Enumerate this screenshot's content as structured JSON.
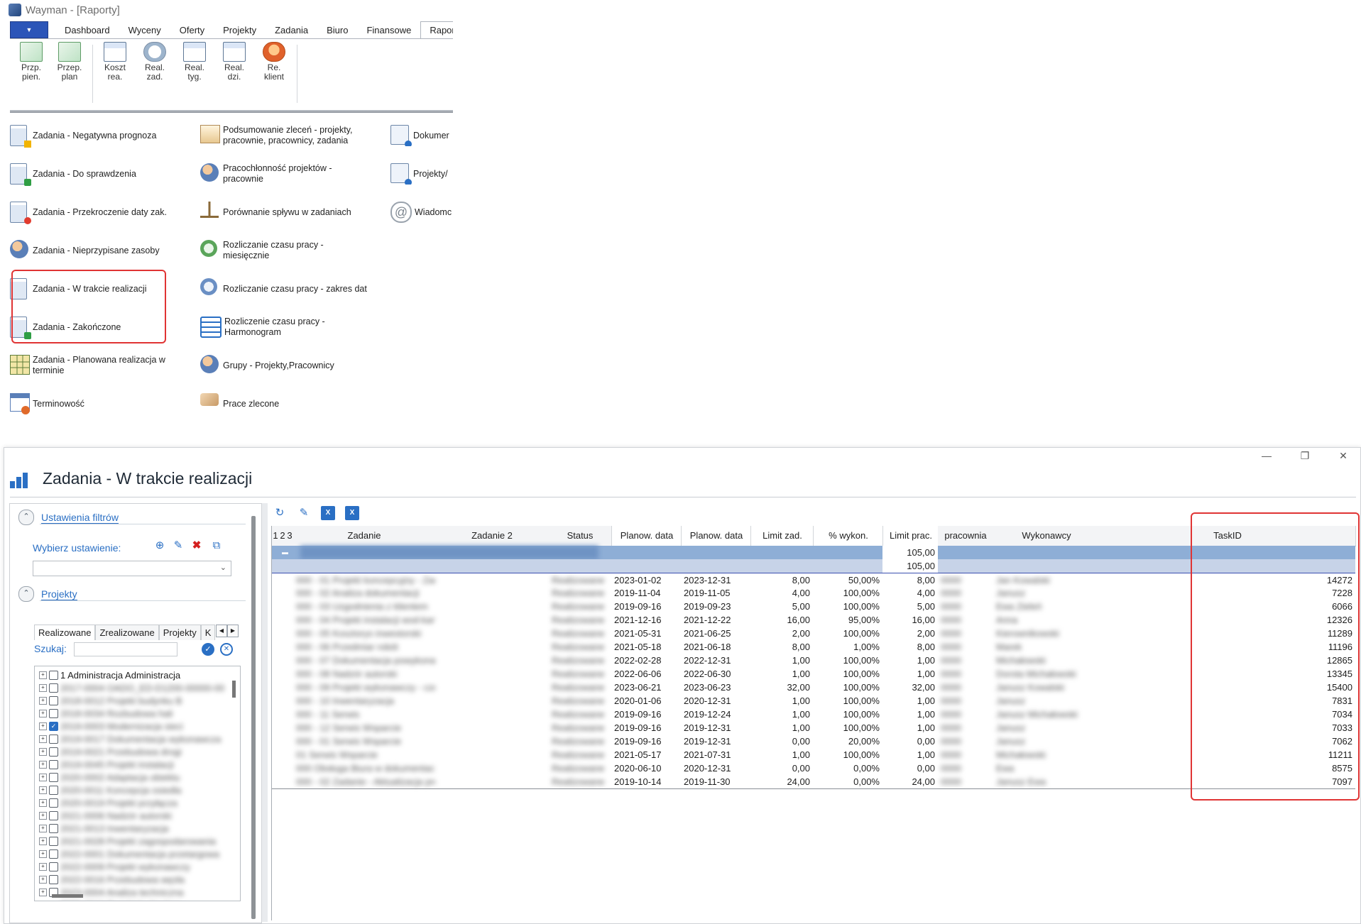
{
  "app": {
    "title": "Wayman - [Raporty]",
    "menu_arrow": "▼"
  },
  "tabs": [
    "Dashboard",
    "Wyceny",
    "Oferty",
    "Projekty",
    "Zadania",
    "Biuro",
    "Finansowe",
    "Raporty"
  ],
  "active_tab": "Raporty",
  "ribbon": [
    {
      "line1": "Przp.",
      "line2": "pien.",
      "icon": "chart-icon"
    },
    {
      "line1": "Przep.",
      "line2": "plan",
      "icon": "chart-icon"
    },
    {
      "line1": "Koszt",
      "line2": "rea.",
      "icon": "calendar-icon"
    },
    {
      "line1": "Real.",
      "line2": "zad.",
      "icon": "clock-icon"
    },
    {
      "line1": "Real.",
      "line2": "tyg.",
      "icon": "calendar-icon"
    },
    {
      "line1": "Real.",
      "line2": "dzi.",
      "icon": "calendar-icon"
    },
    {
      "line1": "Re.",
      "line2": "klient",
      "icon": "person-icon"
    }
  ],
  "reports": {
    "col1": [
      "Zadania - Negatywna prognoza",
      "Zadania - Do sprawdzenia",
      "Zadania - Przekroczenie  daty zak.",
      "Zadania - Nieprzypisane zasoby",
      "Zadania - W trakcie realizacji",
      "Zadania - Zakończone",
      "Zadania - Planowana realizacja w terminie",
      "Terminowość"
    ],
    "col2": [
      "Podsumowanie zleceń - projekty, pracownie, pracownicy, zadania",
      "Pracochłonność projektów - pracownie",
      "Porównanie spływu w zadaniach",
      "Rozliczanie czasu pracy - miesięcznie",
      "Rozliczanie czasu pracy - zakres dat",
      "Rozliczenie czasu pracy - Harmonogram",
      "Grupy - Projekty,Pracownicy",
      "Prace zlecone"
    ],
    "col3": [
      "Dokumer",
      "Projekty/",
      "Wiadomc"
    ]
  },
  "report_window": {
    "title": "Zadania - W trakcie realizacji",
    "controls": {
      "minimize": "—",
      "restore": "❐",
      "close": "✕"
    }
  },
  "filters": {
    "section1": "Ustawienia filtrów",
    "choose_label": "Wybierz ustawienie:",
    "section2": "Projekty",
    "subtabs": [
      "Realizowane",
      "Zrealizowane",
      "Projekty",
      "K"
    ],
    "search_label": "Szukaj:",
    "search_value": "",
    "tree": [
      {
        "label": "1 Administracja Administracja",
        "checked": false,
        "blurred": false
      },
      {
        "label": "2017-0004 OADO_ED-D1200-00000-00",
        "checked": false,
        "blurred": true
      },
      {
        "label": "2018-0012 Projekt budynku B",
        "checked": false,
        "blurred": true
      },
      {
        "label": "2018-0034 Rozbudowa hali",
        "checked": false,
        "blurred": true
      },
      {
        "label": "2019-0003 Modernizacja sieci",
        "checked": true,
        "blurred": true
      },
      {
        "label": "2019-0017 Dokumentacja wykonawcza",
        "checked": false,
        "blurred": true
      },
      {
        "label": "2019-0021 Przebudowa drogi",
        "checked": false,
        "blurred": true
      },
      {
        "label": "2019-0045 Projekt instalacji",
        "checked": false,
        "blurred": true
      },
      {
        "label": "2020-0002 Adaptacja obiektu",
        "checked": false,
        "blurred": true
      },
      {
        "label": "2020-0011 Koncepcja osiedla",
        "checked": false,
        "blurred": true
      },
      {
        "label": "2020-0019 Projekt przyłącza",
        "checked": false,
        "blurred": true
      },
      {
        "label": "2021-0006 Nadzór autorski",
        "checked": false,
        "blurred": true
      },
      {
        "label": "2021-0013 Inwentaryzacja",
        "checked": false,
        "blurred": true
      },
      {
        "label": "2021-0028 Projekt zagospodarowania",
        "checked": false,
        "blurred": true
      },
      {
        "label": "2022-0001 Dokumentacja przetargowa",
        "checked": false,
        "blurred": true
      },
      {
        "label": "2022-0009 Projekt wykonawczy",
        "checked": false,
        "blurred": true
      },
      {
        "label": "2022-0016 Przebudowa węzła",
        "checked": false,
        "blurred": true
      },
      {
        "label": "2023-0004 Analiza techniczna",
        "checked": false,
        "blurred": true
      },
      {
        "label": "2023-0010 Projekt budowlany",
        "checked": false,
        "blurred": true
      },
      {
        "label": "2023-0015 Ekspertyza",
        "checked": false,
        "blurred": true
      },
      {
        "label": "2023-0022 Studium wykonalności",
        "checked": false,
        "blurred": true
      },
      {
        "label": "202 - 01 - 120 - 1180 - Zadanie - Serwis",
        "checked": false,
        "blurred": true
      }
    ]
  },
  "grid": {
    "headers": [
      "1",
      "2",
      "3",
      "Zadanie",
      "Zadanie 2",
      "Status",
      "Planow. data",
      "Planow. data",
      "Limit zad.",
      "% wykon.",
      "Limit prac.",
      "pracownia",
      "Wykonawcy",
      "TaskID"
    ],
    "group_totals": [
      "105,00",
      "105,00"
    ],
    "rows": [
      {
        "zad": "000 - 01 Projekt koncepcyjny - Zadanie",
        "status": "Realizowane",
        "start": "2023-01-02",
        "end": "2023-12-31",
        "limit": "8,00",
        "pct": "50,00%",
        "lp": "8,00",
        "prac": "0000",
        "wyk": "Jan Kowalski",
        "id": "14272"
      },
      {
        "zad": "000 - 02 Analiza dokumentacji",
        "status": "Realizowane",
        "start": "2019-11-04",
        "end": "2019-11-05",
        "limit": "4,00",
        "pct": "100,00%",
        "lp": "4,00",
        "prac": "0000",
        "wyk": "Janusz",
        "id": "7228"
      },
      {
        "zad": "000 - 03 Uzgodnienia z klientem",
        "status": "Realizowane",
        "start": "2019-09-16",
        "end": "2019-09-23",
        "limit": "5,00",
        "pct": "100,00%",
        "lp": "5,00",
        "prac": "0000",
        "wyk": "Ewa Zieleń",
        "id": "6066"
      },
      {
        "zad": "000 - 04 Projekt instalacji wod-kan",
        "status": "Realizowane",
        "start": "2021-12-16",
        "end": "2021-12-22",
        "limit": "16,00",
        "pct": "95,00%",
        "lp": "16,00",
        "prac": "0000",
        "wyk": "Anna",
        "id": "12326"
      },
      {
        "zad": "000 - 05 Kosztorys inwestorski",
        "status": "Realizowane",
        "start": "2021-05-31",
        "end": "2021-06-25",
        "limit": "2,00",
        "pct": "100,00%",
        "lp": "2,00",
        "prac": "0000",
        "wyk": "Kierownikowski",
        "id": "11289"
      },
      {
        "zad": "000 - 06 Przedmiar robót",
        "status": "Realizowane",
        "start": "2021-05-18",
        "end": "2021-06-18",
        "limit": "8,00",
        "pct": "1,00%",
        "lp": "8,00",
        "prac": "0000",
        "wyk": "Marek",
        "id": "11196"
      },
      {
        "zad": "000 - 07 Dokumentacja powykonawcza",
        "status": "Realizowane",
        "start": "2022-02-28",
        "end": "2022-12-31",
        "limit": "1,00",
        "pct": "100,00%",
        "lp": "1,00",
        "prac": "0000",
        "wyk": "Michałowski",
        "id": "12865"
      },
      {
        "zad": "000 - 08 Nadzór autorski",
        "status": "Realizowane",
        "start": "2022-06-06",
        "end": "2022-06-30",
        "limit": "1,00",
        "pct": "100,00%",
        "lp": "1,00",
        "prac": "0000",
        "wyk": "Dorota Michałowski",
        "id": "13345"
      },
      {
        "zad": "000 - 09 Projekt wykonawczy - część B",
        "status": "Realizowane",
        "start": "2023-06-21",
        "end": "2023-06-23",
        "limit": "32,00",
        "pct": "100,00%",
        "lp": "32,00",
        "prac": "0000",
        "wyk": "Janusz Kowalski",
        "id": "15400"
      },
      {
        "zad": "000 - 10 Inwentaryzacja",
        "status": "Realizowane",
        "start": "2020-01-06",
        "end": "2020-12-31",
        "limit": "1,00",
        "pct": "100,00%",
        "lp": "1,00",
        "prac": "0000",
        "wyk": "Janusz",
        "id": "7831"
      },
      {
        "zad": "000 - 11 Serwis",
        "status": "Realizowane",
        "start": "2019-09-16",
        "end": "2019-12-24",
        "limit": "1,00",
        "pct": "100,00%",
        "lp": "1,00",
        "prac": "0000",
        "wyk": "Janusz Michałowski",
        "id": "7034"
      },
      {
        "zad": "000 - 12 Serwis Wsparcie",
        "status": "Realizowane",
        "start": "2019-09-16",
        "end": "2019-12-31",
        "limit": "1,00",
        "pct": "100,00%",
        "lp": "1,00",
        "prac": "0000",
        "wyk": "Janusz",
        "id": "7033"
      },
      {
        "zad": "000 - 01 Serwis Wsparcie",
        "status": "Realizowane",
        "start": "2019-09-16",
        "end": "2019-12-31",
        "limit": "0,00",
        "pct": "20,00%",
        "lp": "0,00",
        "prac": "0000",
        "wyk": "Janusz",
        "id": "7062"
      },
      {
        "zad": "01 Serwis Wsparcie",
        "status": "Realizowane",
        "start": "2021-05-17",
        "end": "2021-07-31",
        "limit": "1,00",
        "pct": "100,00%",
        "lp": "1,00",
        "prac": "0000",
        "wyk": "Michałowski",
        "id": "11211"
      },
      {
        "zad": "000 Obsługa Biura w dokumentach",
        "status": "Realizowane",
        "start": "2020-06-10",
        "end": "2020-12-31",
        "limit": "0,00",
        "pct": "0,00%",
        "lp": "0,00",
        "prac": "0000",
        "wyk": "Ewa",
        "id": "8575"
      },
      {
        "zad": "000 - 02 Zadanie - Aktualizacja projektu",
        "status": "Realizowane",
        "start": "2019-10-14",
        "end": "2019-11-30",
        "limit": "24,00",
        "pct": "0,00%",
        "lp": "24,00",
        "prac": "0000",
        "wyk": "Janusz Ewa",
        "id": "7097"
      }
    ]
  }
}
